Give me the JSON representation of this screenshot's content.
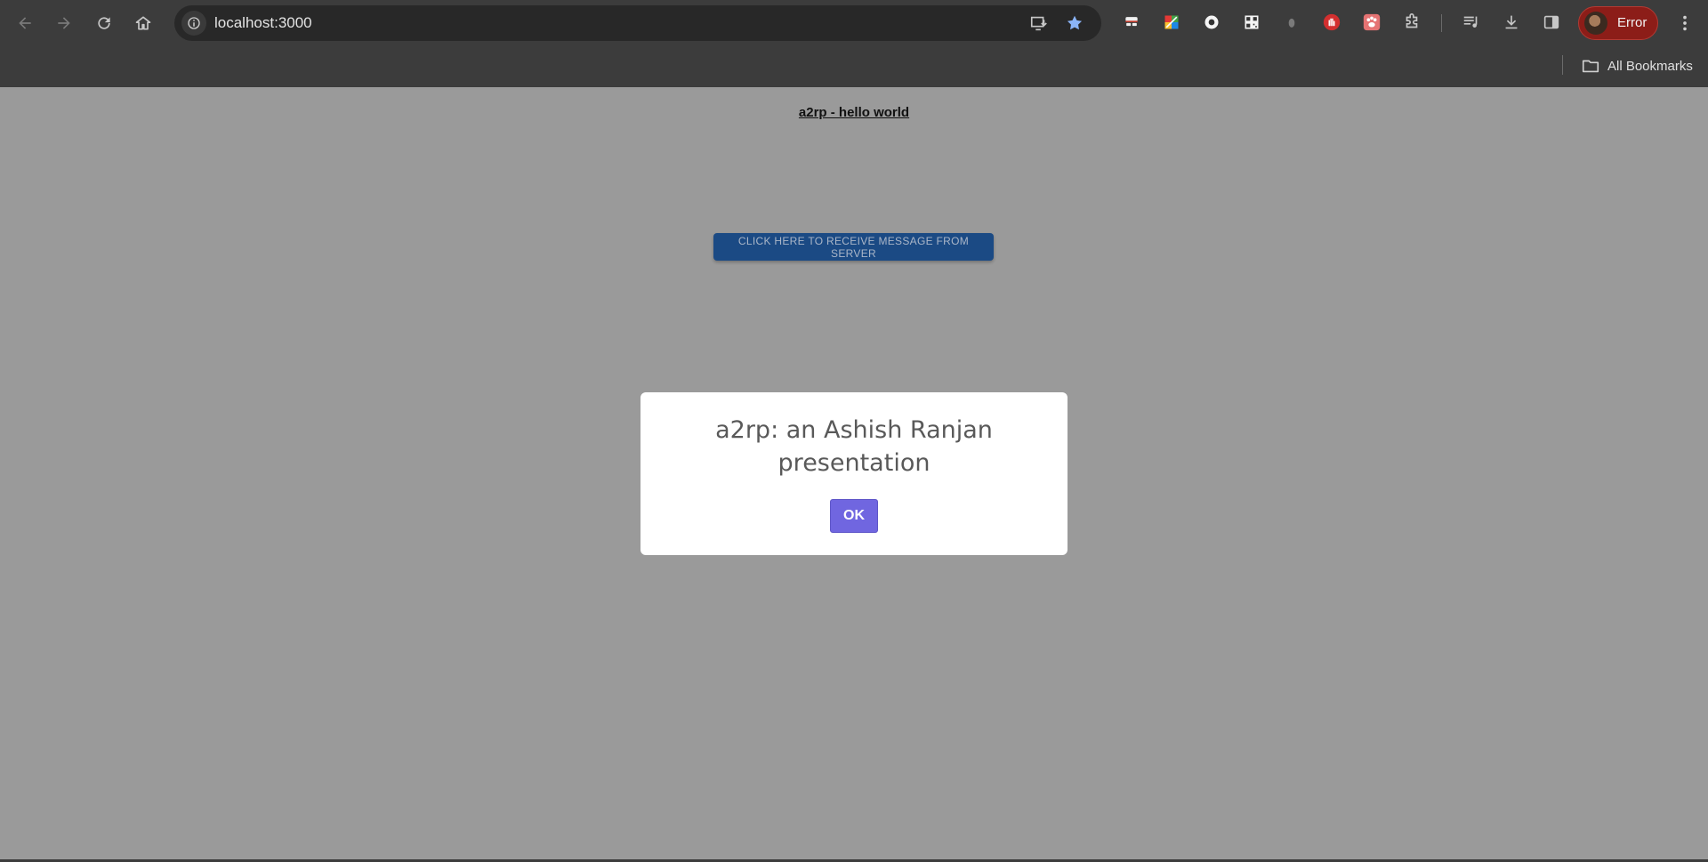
{
  "browser": {
    "url": "localhost:3000",
    "profile_label": "Error",
    "bookmarks_label": "All Bookmarks",
    "icons": {
      "back": "arrow-left-icon",
      "forward": "arrow-right-icon",
      "reload": "reload-icon",
      "home": "home-icon",
      "site_info": "info-icon",
      "install_app": "install-app-icon",
      "bookmark_star": "star-icon",
      "extensions": "puzzle-icon",
      "media": "music-queue-icon",
      "downloads": "download-icon",
      "side_panel": "side-panel-icon",
      "menu": "kebab-menu-icon",
      "bookmarks_folder": "folder-icon"
    },
    "colors": {
      "chrome": "#3c3c3c",
      "omnibox": "#282828",
      "star": "#8ab4f8",
      "profile_pill": "#8c1d18"
    }
  },
  "page": {
    "heading": "a2rp - hello world",
    "server_button_label": "CLICK HERE TO RECEIVE MESSAGE FROM SERVER",
    "background": "#9a9a9a"
  },
  "modal": {
    "title": "a2rp: an Ashish Ranjan presentation",
    "ok_label": "OK",
    "ok_color": "#7066e0"
  }
}
